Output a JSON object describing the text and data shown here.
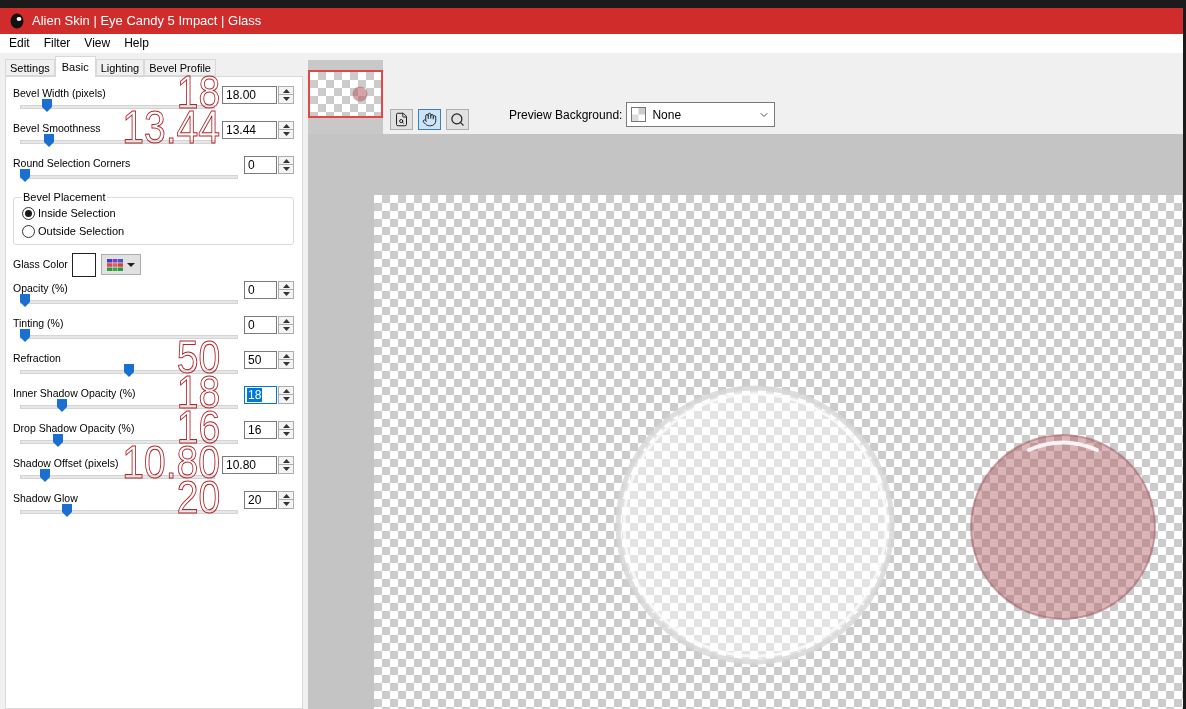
{
  "window": {
    "title": "Alien Skin | Eye Candy 5 Impact | Glass"
  },
  "menu": [
    {
      "label": "Edit"
    },
    {
      "label": "Filter"
    },
    {
      "label": "View"
    },
    {
      "label": "Help"
    }
  ],
  "tabs": [
    {
      "label": "Settings",
      "selected": false
    },
    {
      "label": "Basic",
      "selected": true
    },
    {
      "label": "Lighting",
      "selected": false
    },
    {
      "label": "Bevel Profile",
      "selected": false
    }
  ],
  "controls": [
    {
      "kind": "slider",
      "label": "Bevel Width (pixels)",
      "value": "18.00",
      "level": 0.12,
      "focused": false,
      "annotation": "18"
    },
    {
      "kind": "slider",
      "label": "Bevel Smoothness",
      "value": "13.44",
      "level": 0.13,
      "focused": false,
      "annotation": "13.44"
    },
    {
      "kind": "slider",
      "label": "Round Selection Corners",
      "value": "0",
      "level": 0,
      "focused": false
    },
    {
      "kind": "radio_group",
      "title": "Bevel Placement",
      "options": [
        {
          "label": "Inside Selection",
          "selected": true
        },
        {
          "label": "Outside Selection",
          "selected": false
        }
      ]
    },
    {
      "kind": "color",
      "label": "Glass Color",
      "color": "#ffffff"
    },
    {
      "kind": "slider",
      "label": "Opacity (%)",
      "value": "0",
      "level": 0,
      "focused": false
    },
    {
      "kind": "slider",
      "label": "Tinting (%)",
      "value": "0",
      "level": 0,
      "focused": false
    },
    {
      "kind": "slider",
      "label": "Refraction",
      "value": "50",
      "level": 0.5,
      "focused": false,
      "annotation": "50"
    },
    {
      "kind": "slider",
      "label": "Inner Shadow Opacity (%)",
      "value": "18",
      "level": 0.18,
      "focused": true,
      "annotation": "18"
    },
    {
      "kind": "slider",
      "label": "Drop Shadow Opacity (%)",
      "value": "16",
      "level": 0.16,
      "focused": false,
      "annotation": "16"
    },
    {
      "kind": "slider",
      "label": "Shadow Offset (pixels)",
      "value": "10.80",
      "level": 0.108,
      "focused": false,
      "annotation": "10.80"
    },
    {
      "kind": "slider",
      "label": "Shadow Glow",
      "value": "20",
      "level": 0.2,
      "focused": false,
      "annotation": "20"
    }
  ],
  "preview": {
    "tools": [
      {
        "kind": "navigator",
        "selected": false
      },
      {
        "kind": "hand",
        "selected": true
      },
      {
        "kind": "zoom",
        "selected": false
      }
    ],
    "background_label": "Preview Background:",
    "background_value": "None"
  }
}
